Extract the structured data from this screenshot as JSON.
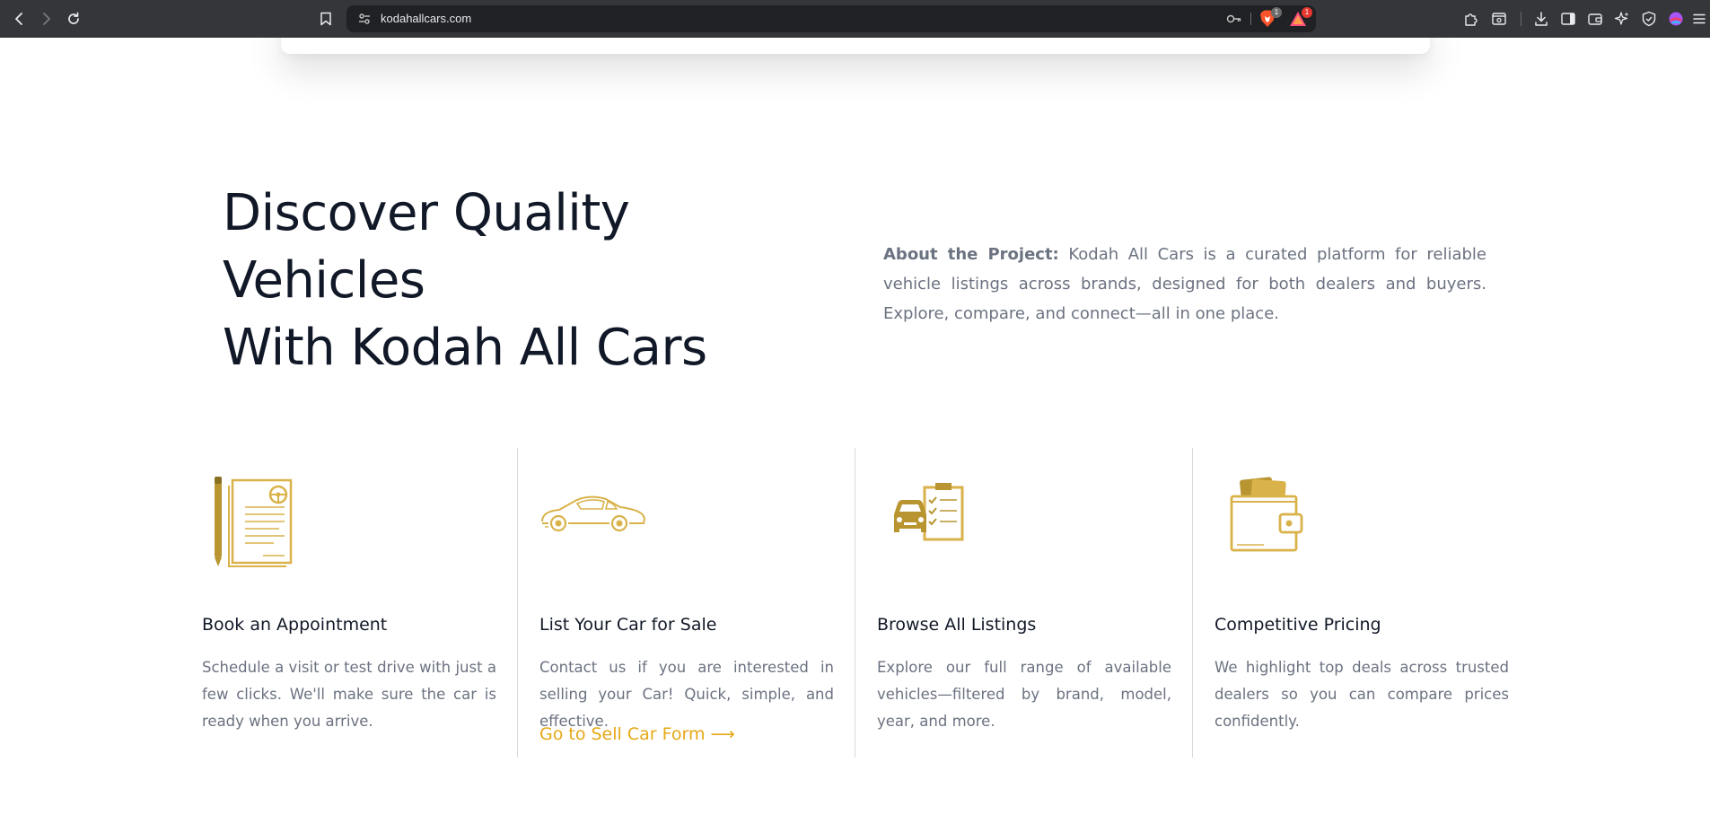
{
  "browser": {
    "url": "kodahallcars.com",
    "brave_shields_count": "1",
    "rewards_count": "1"
  },
  "hero": {
    "title_line1": "Discover Quality",
    "title_line2": "Vehicles",
    "title_line3": "With Kodah All Cars",
    "about_label": "About the Project:",
    "about_text": " Kodah All Cars is a curated platform for reliable vehicle listings across brands, designed for both dealers and buyers. Explore, compare, and connect—all in one place."
  },
  "features": [
    {
      "icon": "appointment-document-icon",
      "title": "Book an Appointment",
      "description": "Schedule a visit or test drive with just a few clicks. We'll make sure the car is ready when you arrive."
    },
    {
      "icon": "car-icon",
      "title": "List Your Car for Sale",
      "description": "Contact us if you are interested in selling your Car! Quick, simple, and effective.",
      "link_label": "Go to Sell Car Form ⟶"
    },
    {
      "icon": "car-checklist-icon",
      "title": "Browse All Listings",
      "description": "Explore our full range of available vehicles—filtered by brand, model, year, and more."
    },
    {
      "icon": "wallet-icon",
      "title": "Competitive Pricing",
      "description": "We highlight top deals across trusted dealers so you can compare prices confidently."
    }
  ],
  "colors": {
    "accent": "#e6a817",
    "icon_gold": "#d9b24a",
    "heading": "#111827",
    "body_text": "#6b7280"
  }
}
